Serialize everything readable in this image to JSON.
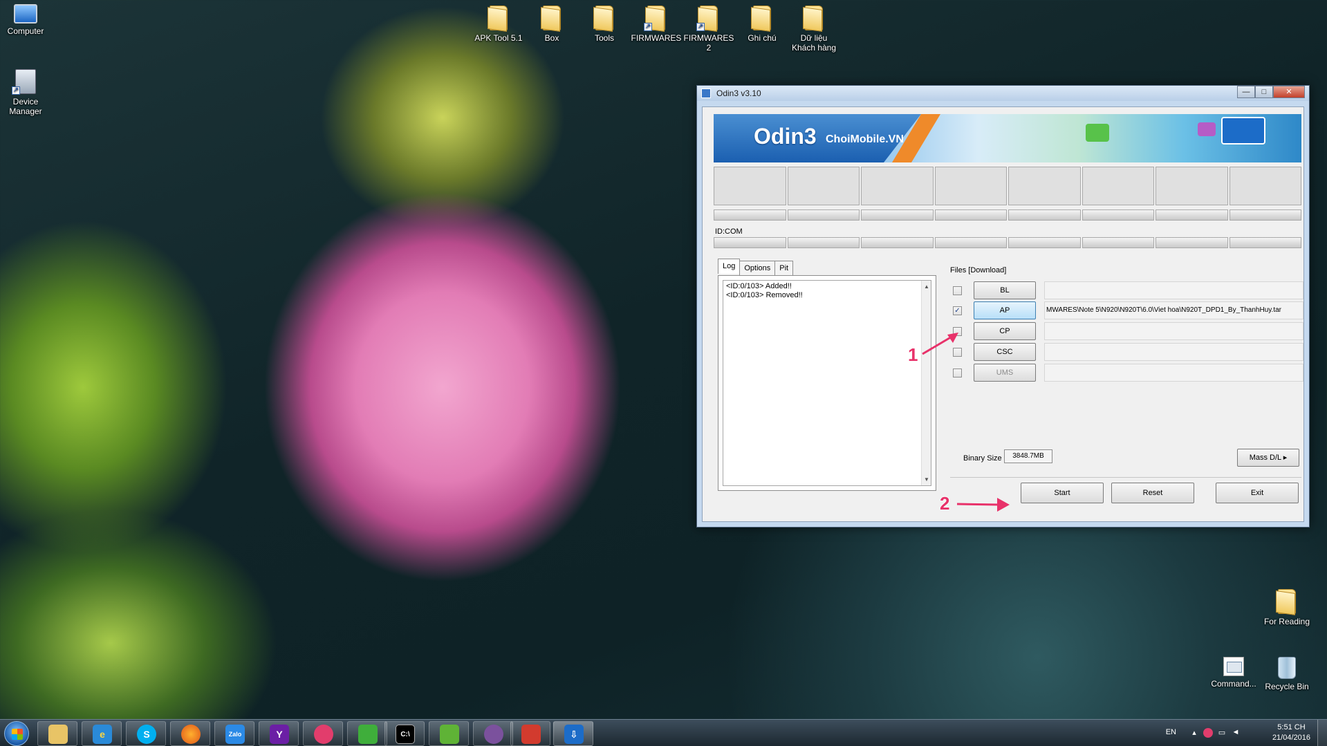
{
  "desktop": {
    "icons": {
      "computer": "Computer",
      "device_manager": "Device\nManager",
      "apk_tool": "APK Tool 5.1",
      "box": "Box",
      "tools": "Tools",
      "firmwares": "FIRMWARES",
      "firmwares2": "FIRMWARES\n2",
      "ghi_chu": "Ghi chú",
      "du_lieu": "Dữ liệu\nKhách hàng",
      "for_reading": "For Reading",
      "command": "Command...",
      "recycle_bin": "Recycle Bin"
    }
  },
  "odin": {
    "title": "Odin3 v3.10",
    "buttons": {
      "minimize": "—",
      "maximize": "□",
      "close": "✕"
    },
    "banner": {
      "logo": "Odin3",
      "brand": "ChoiMobile.VN"
    },
    "idcom_label": "ID:COM",
    "tabs": [
      "Log",
      "Options",
      "Pit"
    ],
    "log_lines": [
      "<ID:0/103> Added!!",
      "<ID:0/103> Removed!!"
    ],
    "files_label": "Files [Download]",
    "files": [
      {
        "label": "BL",
        "checked": false,
        "path": ""
      },
      {
        "label": "AP",
        "checked": true,
        "path": "MWARES\\Note 5\\N920\\N920T\\6.0\\Viet hoa\\N920T_DPD1_By_ThanhHuy.tar"
      },
      {
        "label": "CP",
        "checked": false,
        "path": ""
      },
      {
        "label": "CSC",
        "checked": false,
        "path": ""
      },
      {
        "label": "UMS",
        "checked": false,
        "path": ""
      }
    ],
    "binary_size_label": "Binary Size",
    "binary_size_value": "3848.7MB",
    "mass_dl": "Mass D/L ▸",
    "start": "Start",
    "reset": "Reset",
    "exit": "Exit"
  },
  "annotations": {
    "one": "1",
    "two": "2",
    "color": "#e8326a"
  },
  "taskbar": {
    "language": "EN",
    "time": "5:51 CH",
    "date": "21/04/2016"
  }
}
